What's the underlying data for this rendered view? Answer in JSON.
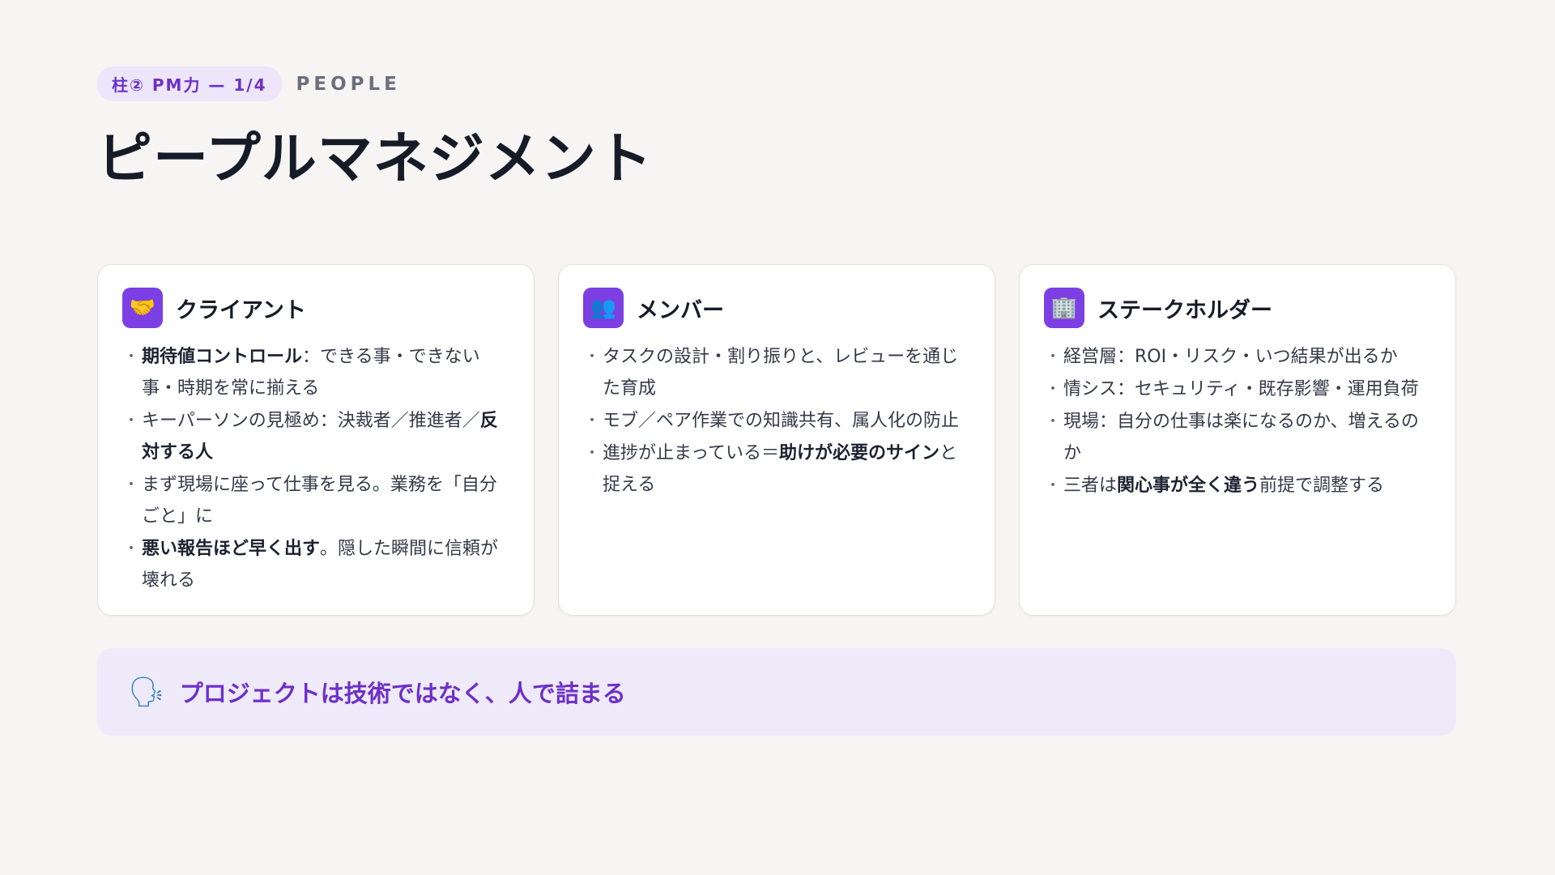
{
  "header": {
    "pill": "柱② PM力 — 1/4",
    "eyebrow": "PEOPLE",
    "title": "ピープルマネジメント"
  },
  "cards": [
    {
      "icon": "handshake-icon",
      "icon_glyph": "🤝",
      "title": "クライアント",
      "bullets": [
        [
          {
            "b": "期待値コントロール"
          },
          {
            "t": "：できる事・できない事・時期を常に揃える"
          }
        ],
        [
          {
            "t": "キーパーソンの見極め：決裁者／推進者／"
          },
          {
            "b": "反対する人"
          }
        ],
        [
          {
            "t": "まず現場に座って仕事を見る。業務を「自分ごと」に"
          }
        ],
        [
          {
            "b": "悪い報告ほど早く出す"
          },
          {
            "t": "。隠した瞬間に信頼が壊れる"
          }
        ]
      ]
    },
    {
      "icon": "people-icon",
      "icon_glyph": "👥",
      "title": "メンバー",
      "bullets": [
        [
          {
            "t": "タスクの設計・割り振りと、レビューを通じた育成"
          }
        ],
        [
          {
            "t": "モブ／ペア作業での知識共有、属人化の防止"
          }
        ],
        [
          {
            "t": "進捗が止まっている＝"
          },
          {
            "b": "助けが必要のサイン"
          },
          {
            "t": "と捉える"
          }
        ]
      ]
    },
    {
      "icon": "office-building-icon",
      "icon_glyph": "🏢",
      "title": "ステークホルダー",
      "bullets": [
        [
          {
            "t": "経営層：ROI・リスク・いつ結果が出るか"
          }
        ],
        [
          {
            "t": "情シス：セキュリティ・既存影響・運用負荷"
          }
        ],
        [
          {
            "t": "現場：自分の仕事は楽になるのか、増えるのか"
          }
        ],
        [
          {
            "t": "三者は"
          },
          {
            "b": "関心事が全く違う"
          },
          {
            "t": "前提で調整する"
          }
        ]
      ]
    }
  ],
  "callout": {
    "icon": "speaking-head-icon",
    "icon_glyph": "🗣",
    "text": "プロジェクトは技術ではなく、人で詰まる"
  },
  "colors": {
    "accent": "#7b3fe4",
    "accent_text": "#6d30c9",
    "callout_bg": "#efeafa",
    "page_bg": "#f6f5f3"
  }
}
